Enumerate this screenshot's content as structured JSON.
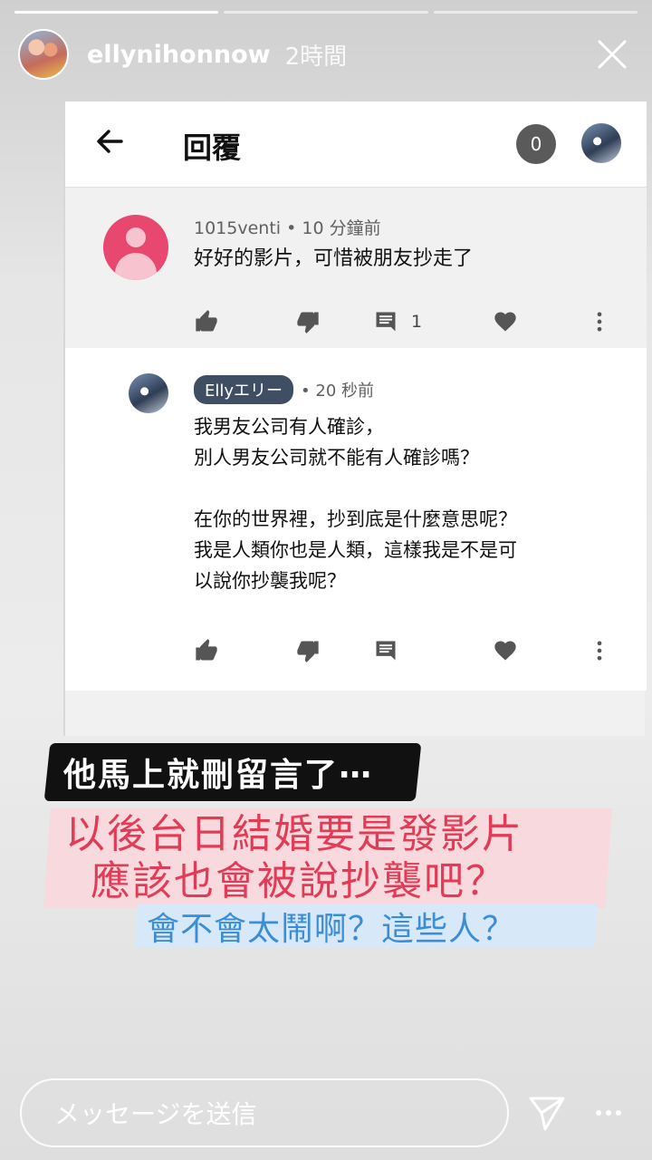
{
  "story": {
    "username": "ellynihonnow",
    "time": "2時間",
    "progress_segments": 3,
    "active_segment": 1
  },
  "comment_screen": {
    "title": "回覆",
    "count_badge": "0",
    "comment": {
      "author": "1015venti",
      "time": "10 分鐘前",
      "text": "好好的影片，可惜被朋友抄走了",
      "reply_count": "1"
    },
    "reply": {
      "author": "Ellyエリー",
      "time": "• 20 秒前",
      "lines": [
        "我男友公司有人確診，",
        "別人男友公司就不能有人確診嗎？",
        "",
        "在你的世界裡，抄到底是什麼意思呢？",
        "我是人類你也是人類，這樣我是不是可",
        "以說你抄襲我呢？"
      ]
    }
  },
  "overlay": {
    "black_text": "他馬上就刪留言了⋯",
    "red_line1": "以後台日結婚要是發影片",
    "red_line2": "應該也會被說抄襲吧？",
    "blue_text": "會不會太鬧啊？這些人？"
  },
  "footer": {
    "message_placeholder": "メッセージを送信"
  },
  "colors": {
    "red_text": "#e23b55",
    "blue_text": "#3b8ed6",
    "author_chip": "#3f4e63",
    "comment_avatar": "#e8476f"
  }
}
